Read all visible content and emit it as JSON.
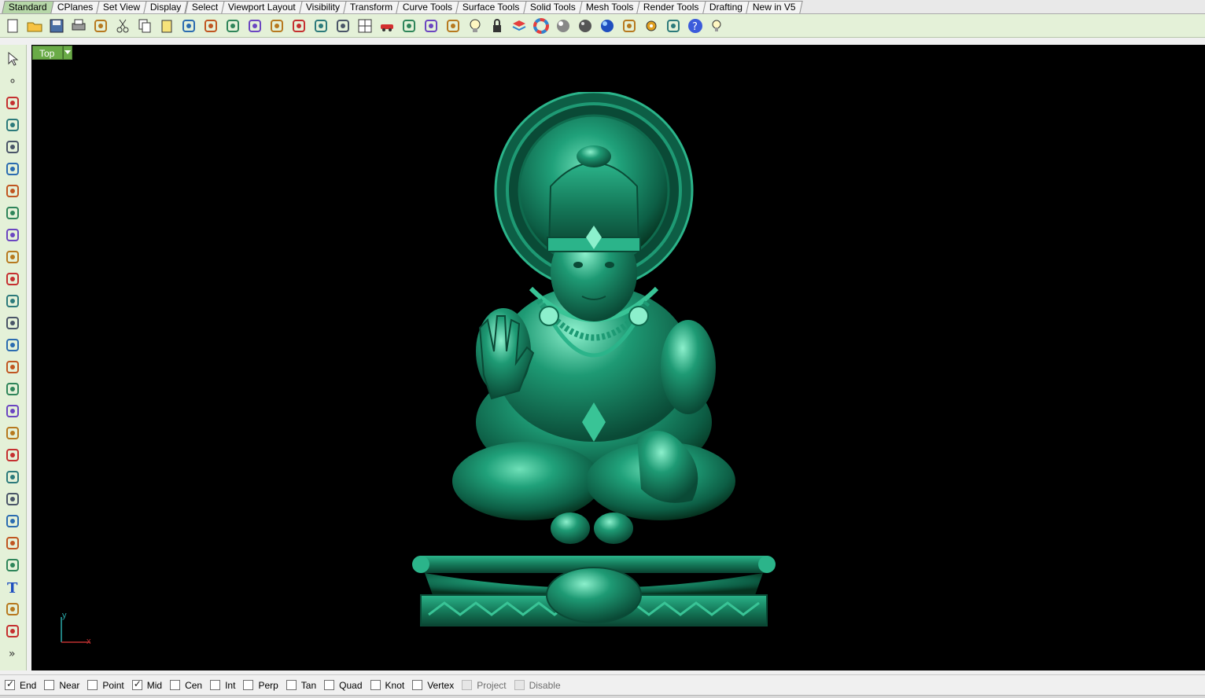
{
  "tabs": [
    "Standard",
    "CPlanes",
    "Set View",
    "Display",
    "Select",
    "Viewport Layout",
    "Visibility",
    "Transform",
    "Curve Tools",
    "Surface Tools",
    "Solid Tools",
    "Mesh Tools",
    "Render Tools",
    "Drafting",
    "New in V5"
  ],
  "active_tab": "Standard",
  "toolbar_icons": [
    "new-file-icon",
    "open-file-icon",
    "save-icon",
    "print-icon",
    "import-icon",
    "cut-icon",
    "copy-icon",
    "paste-icon",
    "undo-icon",
    "pan-icon",
    "rotate-view-icon",
    "zoom-icon",
    "zoom-window-icon",
    "zoom-extents-icon",
    "zoom-selected-icon",
    "undo-view-icon",
    "four-viewports-icon",
    "car-icon",
    "shaded-car-icon",
    "circle-dotted-icon",
    "points-icon",
    "light-bulb-icon",
    "lock-icon",
    "layer-icon",
    "color-wheel-icon",
    "material-sphere-icon",
    "env-sphere-icon",
    "render-sphere-icon",
    "cone-icon",
    "settings-gear-icon",
    "grid-snap-icon",
    "help-icon",
    "tips-icon"
  ],
  "left_icons": [
    "select-arrow-icon",
    "point-icon",
    "polyline-icon",
    "curve-icon",
    "circle-icon",
    "ellipse-icon",
    "polygon-triangle-icon",
    "rectangle-icon",
    "polygon-icon",
    "fillet-curve-icon",
    "surface-cp-icon",
    "sweep-icon",
    "box-icon",
    "boolean-icon",
    "cylinder-extrude-icon",
    "mesh-surface-icon",
    "gear-transform-icon",
    "arrow-flow-icon",
    "edit-tools-icon",
    "dimension-icon",
    "group-icon",
    "array-icon",
    "curve-edit-icon",
    "curve-fillet-icon",
    "text-icon",
    "scale-icon",
    "array-grid-icon",
    "more-chevron-icon"
  ],
  "viewport": {
    "title": "Top",
    "axis_x": "x",
    "axis_y": "y",
    "model_color": "#1a8a66"
  },
  "snaps": [
    {
      "label": "End",
      "checked": true,
      "enabled": true
    },
    {
      "label": "Near",
      "checked": false,
      "enabled": true
    },
    {
      "label": "Point",
      "checked": false,
      "enabled": true
    },
    {
      "label": "Mid",
      "checked": true,
      "enabled": true
    },
    {
      "label": "Cen",
      "checked": false,
      "enabled": true
    },
    {
      "label": "Int",
      "checked": false,
      "enabled": true
    },
    {
      "label": "Perp",
      "checked": false,
      "enabled": true
    },
    {
      "label": "Tan",
      "checked": false,
      "enabled": true
    },
    {
      "label": "Quad",
      "checked": false,
      "enabled": true
    },
    {
      "label": "Knot",
      "checked": false,
      "enabled": true
    },
    {
      "label": "Vertex",
      "checked": false,
      "enabled": true
    },
    {
      "label": "Project",
      "checked": false,
      "enabled": false
    },
    {
      "label": "Disable",
      "checked": false,
      "enabled": false
    }
  ]
}
